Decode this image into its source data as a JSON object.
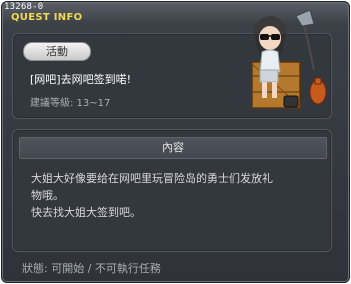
{
  "quest_id": "13268-0",
  "window_title": "QUEST INFO",
  "category_badge": "活動",
  "quest": {
    "title": "[网吧]去网吧签到喏!",
    "recommend_level": "建議等級: 13~17"
  },
  "content": {
    "header": "內容",
    "line1": "大姐大好像要给在网吧里玩冒险岛的勇士们发放礼",
    "line2": "物哦。",
    "line3": "快去找大姐大签到吧。"
  },
  "status_text": "狀態: 可開始 / 不可執行任務",
  "npc_icon": "npc-sunglasses-girl-on-crate",
  "colors": {
    "title": "#f3d94e",
    "panel": "#33373e"
  }
}
